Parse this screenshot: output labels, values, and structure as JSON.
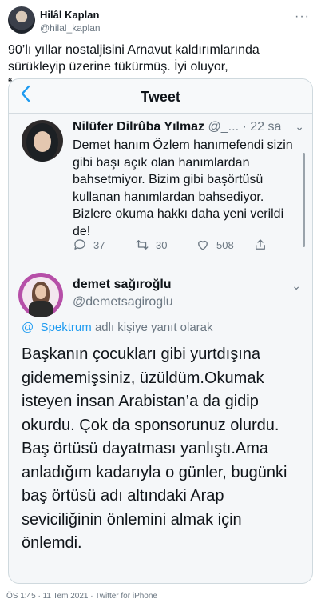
{
  "author": {
    "name": "Hilâl Kaplan",
    "handle": "@hilal_kaplan"
  },
  "tweet": {
    "text": "90’lı yıllar nostaljisini Arnavut kaldırımlarında sürükleyip üzerine tükürmüş. İyi oluyor, “aydınlanıyoruz”.."
  },
  "screenshot": {
    "nav_title": "Tweet",
    "quoted": {
      "name": "Nilüfer Dilrûba Yılmaz",
      "handle": "@_...",
      "time": "22 sa",
      "text": "Demet hanım Özlem hanımefendi sizin gibi başı açık olan hanımlardan bahsetmiyor. Bizim gibi başörtüsü kullanan hanımlardan bahsediyor. Bizlere okuma hakkı daha yeni verildi de!",
      "actions": {
        "replies": "37",
        "retweets": "30",
        "likes": "508"
      }
    },
    "reply": {
      "name": "demet sağıroğlu",
      "handle": "@demetsagiroglu",
      "reply_to_handle": "@_Spektrum",
      "reply_to_suffix": "adlı kişiye yanıt olarak",
      "text": "Başkanın çocukları gibi yurtdışına gidememişsiniz, üzüldüm.Okumak isteyen insan Arabistan’a da gidip okurdu. Çok da sponsorunuz olurdu. Baş örtüsü dayatması yanlıştı.Ama anladığım kadarıyla o günler, bugünki baş örtüsü adı altındaki Arap seviciliğinin önlemini almak için önlemdi."
    }
  },
  "footer": {
    "meta": "ÖS 1:45 · 11 Tem 2021 · Twitter for iPhone"
  },
  "colors": {
    "accent": "#1d9bf0",
    "muted": "#6b7782",
    "border": "#cfd9de"
  },
  "icons": [
    "more-icon",
    "back-chevron-icon",
    "reply-icon",
    "retweet-icon",
    "like-icon",
    "share-icon"
  ]
}
